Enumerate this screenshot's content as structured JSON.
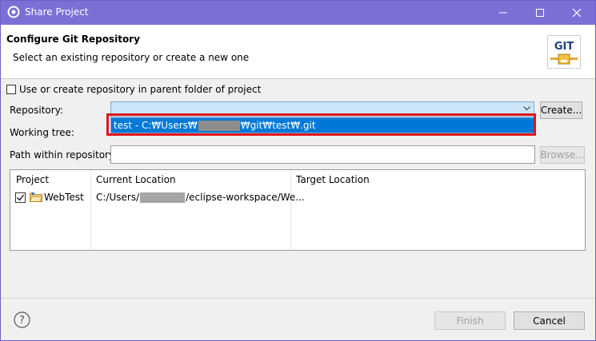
{
  "window": {
    "title": "Share Project"
  },
  "header": {
    "title": "Configure Git Repository",
    "subtitle": "Select an existing repository or create a new one",
    "logo_text": "GIT"
  },
  "parent_folder_checkbox": {
    "label": "Use or create repository in parent folder of project",
    "checked": false
  },
  "repository": {
    "label": "Repository:",
    "create_button": "Create...",
    "dropdown_option_prefix": "test - C:₩Users₩",
    "dropdown_option_suffix": "₩git₩test₩.git"
  },
  "working_tree": {
    "label": "Working tree:"
  },
  "path": {
    "label": "Path within repository:",
    "value": "",
    "browse_button": "Browse..."
  },
  "table": {
    "headers": {
      "project": "Project",
      "current": "Current Location",
      "target": "Target Location"
    },
    "rows": [
      {
        "project": "WebTest",
        "checked": true,
        "current_prefix": "C:/Users/",
        "current_suffix": "/eclipse-workspace/We...",
        "target": ""
      }
    ]
  },
  "footer": {
    "finish_button": "Finish",
    "cancel_button": "Cancel"
  },
  "colors": {
    "titlebar": "#7b6fd6",
    "selection": "#0078d7",
    "highlight_border": "#e0161b"
  }
}
